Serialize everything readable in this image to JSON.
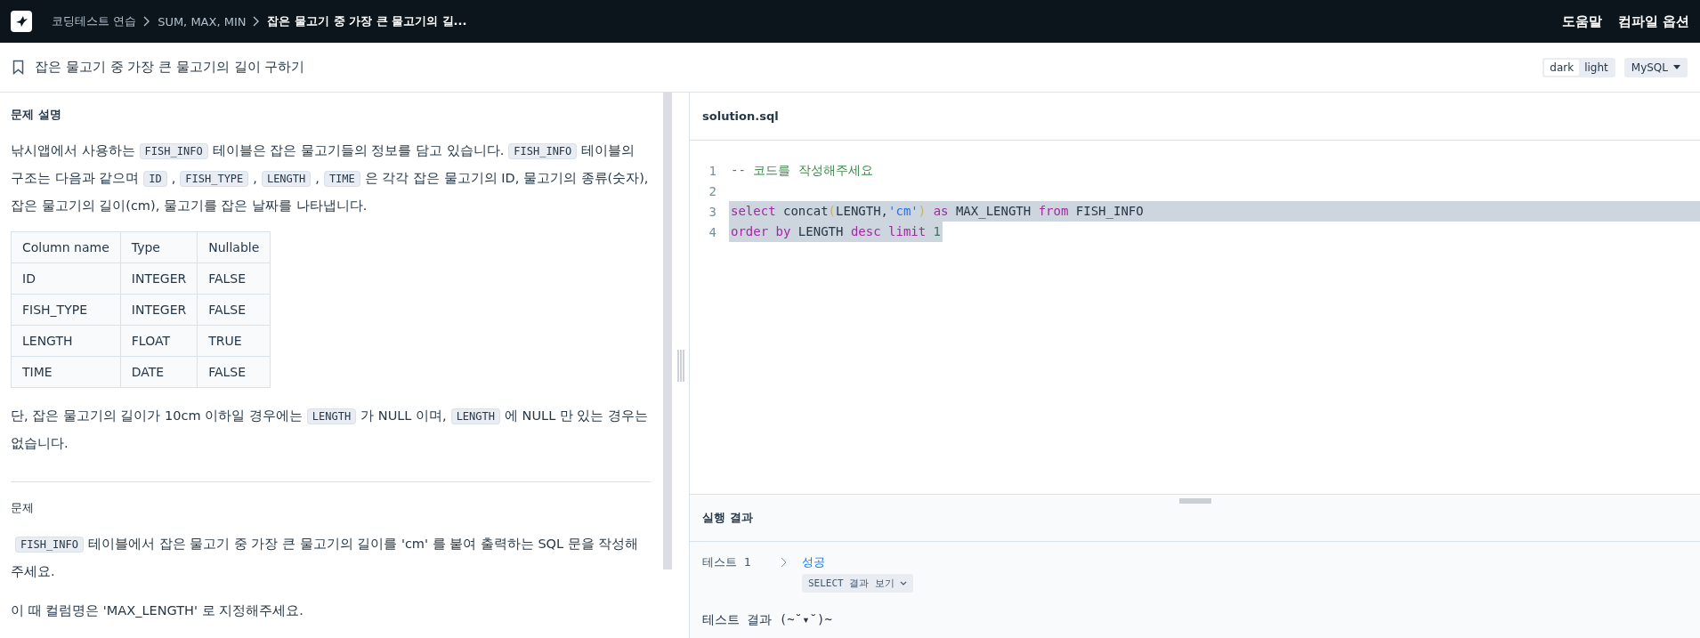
{
  "top_bar": {
    "breadcrumbs": [
      {
        "label": "코딩테스트 연습",
        "current": false
      },
      {
        "label": "SUM, MAX, MIN",
        "current": false
      },
      {
        "label": "잡은 물고기 중 가장 큰 물고기의 길...",
        "current": true
      }
    ],
    "menu": [
      "도움말",
      "컴파일 옵션"
    ]
  },
  "title_bar": {
    "title": "잡은 물고기 중 가장 큰 물고기의 길이 구하기",
    "bookmarked": false,
    "themes": [
      {
        "label": "dark",
        "selected": true
      },
      {
        "label": "light",
        "selected": false
      }
    ],
    "language": "MySQL"
  },
  "description": {
    "sections": [
      {
        "heading": "문제 설명",
        "heading_bold": true,
        "blocks": [
          {
            "kind": "paragraph",
            "segments": [
              {
                "kind": "text",
                "text": "낚시앱에서 사용하는"
              },
              {
                "kind": "code",
                "text": "FISH_INFO"
              },
              {
                "kind": "text",
                "text": "테이블은 잡은 물고기들의 정보를 담고 있습니다."
              },
              {
                "kind": "code",
                "text": "FISH_INFO"
              },
              {
                "kind": "text",
                "text": "테이블의 구조는 다음과 같으며"
              },
              {
                "kind": "code",
                "text": "ID"
              },
              {
                "kind": "text",
                "text": ","
              },
              {
                "kind": "code",
                "text": "FISH_TYPE"
              },
              {
                "kind": "text",
                "text": ","
              },
              {
                "kind": "code",
                "text": "LENGTH"
              },
              {
                "kind": "text",
                "text": ","
              },
              {
                "kind": "code",
                "text": "TIME"
              },
              {
                "kind": "text",
                "text": "은 각각 잡은 물고기의 ID, 물고기의 종류(숫자), 잡은 물고기의 길이(cm), 물고기를 잡은 날짜를 나타냅니다."
              }
            ]
          },
          {
            "kind": "table",
            "columns": [
              "Column name",
              "Type",
              "Nullable"
            ],
            "rows": [
              [
                "ID",
                "INTEGER",
                "FALSE"
              ],
              [
                "FISH_TYPE",
                "INTEGER",
                "FALSE"
              ],
              [
                "LENGTH",
                "FLOAT",
                "TRUE"
              ],
              [
                "TIME",
                "DATE",
                "FALSE"
              ]
            ]
          },
          {
            "kind": "paragraph",
            "segments": [
              {
                "kind": "text",
                "text": "단, 잡은 물고기의 길이가 10cm 이하일 경우에는"
              },
              {
                "kind": "code",
                "text": "LENGTH"
              },
              {
                "kind": "text",
                "text": "가 NULL 이며,"
              },
              {
                "kind": "code",
                "text": "LENGTH"
              },
              {
                "kind": "text",
                "text": "에 NULL 만 있는 경우는 없습니다."
              }
            ]
          }
        ]
      },
      {
        "heading": "문제",
        "heading_bold": false,
        "blocks": [
          {
            "kind": "paragraph",
            "segments": [
              {
                "kind": "code",
                "text": "FISH_INFO"
              },
              {
                "kind": "text",
                "text": "테이블에서 잡은 물고기 중 가장 큰 물고기의 길이를 'cm' 를 붙여 출력하는 SQL 문을 작성해주세요."
              }
            ]
          },
          {
            "kind": "paragraph",
            "segments": [
              {
                "kind": "text",
                "text": "이 때 컬럼명은 'MAX_LENGTH' 로 지정해주세요."
              }
            ]
          }
        ]
      }
    ]
  },
  "editor": {
    "file_name": "solution.sql",
    "lines": [
      {
        "number": "1",
        "selected": false,
        "tokens": [
          {
            "kind": "comment",
            "text": "-- 코드를 작성해주세요"
          }
        ]
      },
      {
        "number": "2",
        "selected": false
      },
      {
        "number": "3",
        "selected": true,
        "tokens": [
          {
            "kind": "keyword",
            "text": "select"
          },
          {
            "kind": "plain",
            "text": " concat"
          },
          {
            "kind": "paren",
            "text": "("
          },
          {
            "kind": "plain",
            "text": "LENGTH,"
          },
          {
            "kind": "string",
            "text": "'cm'"
          },
          {
            "kind": "paren",
            "text": ")"
          },
          {
            "kind": "keyword",
            "text": " as"
          },
          {
            "kind": "plain",
            "text": " MAX_LENGTH "
          },
          {
            "kind": "keyword",
            "text": "from"
          },
          {
            "kind": "plain",
            "text": " FISH_INFO"
          }
        ]
      },
      {
        "number": "4",
        "selected": true,
        "tokens": [
          {
            "kind": "keyword",
            "text": "order by"
          },
          {
            "kind": "plain",
            "text": " LENGTH "
          },
          {
            "kind": "keyword",
            "text": "desc limit"
          },
          {
            "kind": "number",
            "text": " 1"
          }
        ]
      }
    ]
  },
  "results": {
    "title": "실행 결과",
    "tests": [
      {
        "label": "테스트 1",
        "status": "성공",
        "passed": true,
        "button": "SELECT 결과 보기"
      }
    ],
    "summary": "테스트 결과 (~˘▾˘)~"
  }
}
